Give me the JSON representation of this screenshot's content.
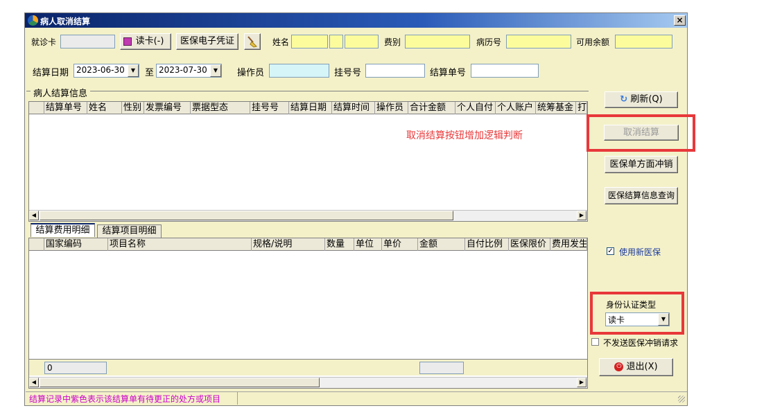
{
  "window": {
    "title": "病人取消结算",
    "close_glyph": "×"
  },
  "row1": {
    "card_label": "就诊卡",
    "read_card_button": "读卡(-)",
    "e_voucher_button": "医保电子凭证",
    "name_label": "姓名",
    "fee_type_label": "费别",
    "record_no_label": "病历号",
    "balance_label": "可用余额"
  },
  "row2": {
    "settle_date_label": "结算日期",
    "date_from": "2023-06-30",
    "to_label": "至",
    "date_to": "2023-07-30",
    "operator_label": "操作员",
    "reg_no_label": "挂号号",
    "settle_no_label": "结算单号"
  },
  "settle_info": {
    "group_title": "病人结算信息",
    "columns": [
      "结算单号",
      "姓名",
      "性别",
      "发票编号",
      "票据型态",
      "挂号号",
      "结算日期",
      "结算时间",
      "操作员",
      "合计金额",
      "个人自付",
      "个人账户",
      "统筹基金",
      "打"
    ],
    "annotation": "取消结算按钮增加逻辑判断"
  },
  "detail": {
    "tabs": [
      "结算费用明细",
      "结算项目明细"
    ],
    "columns": [
      "国家编码",
      "项目名称",
      "规格/说明",
      "数量",
      "单位",
      "单价",
      "金额",
      "自付比例",
      "医保限价",
      "费用发生"
    ],
    "footer_value": "0"
  },
  "side": {
    "refresh_button": "刷新(Q)",
    "cancel_button": "取消结算",
    "offset_button": "医保单方面冲销",
    "query_button": "医保结算信息查询",
    "use_new_label": "使用新医保",
    "use_new_checked": true,
    "auth_type_label": "身份认证类型",
    "auth_type_value": "读卡",
    "no_cancel_label": "不发送医保冲销请求",
    "no_cancel_checked": false,
    "exit_button": "退出(X)"
  },
  "status_bar": {
    "text": "结算记录中紫色表示该结算单有待更正的处方或项目"
  },
  "colors": {
    "annotation_red": "#e8383a",
    "status_magenta": "#cc00cc",
    "field_yellow": "#fdfc9d",
    "field_cyan": "#d6f5f8"
  }
}
